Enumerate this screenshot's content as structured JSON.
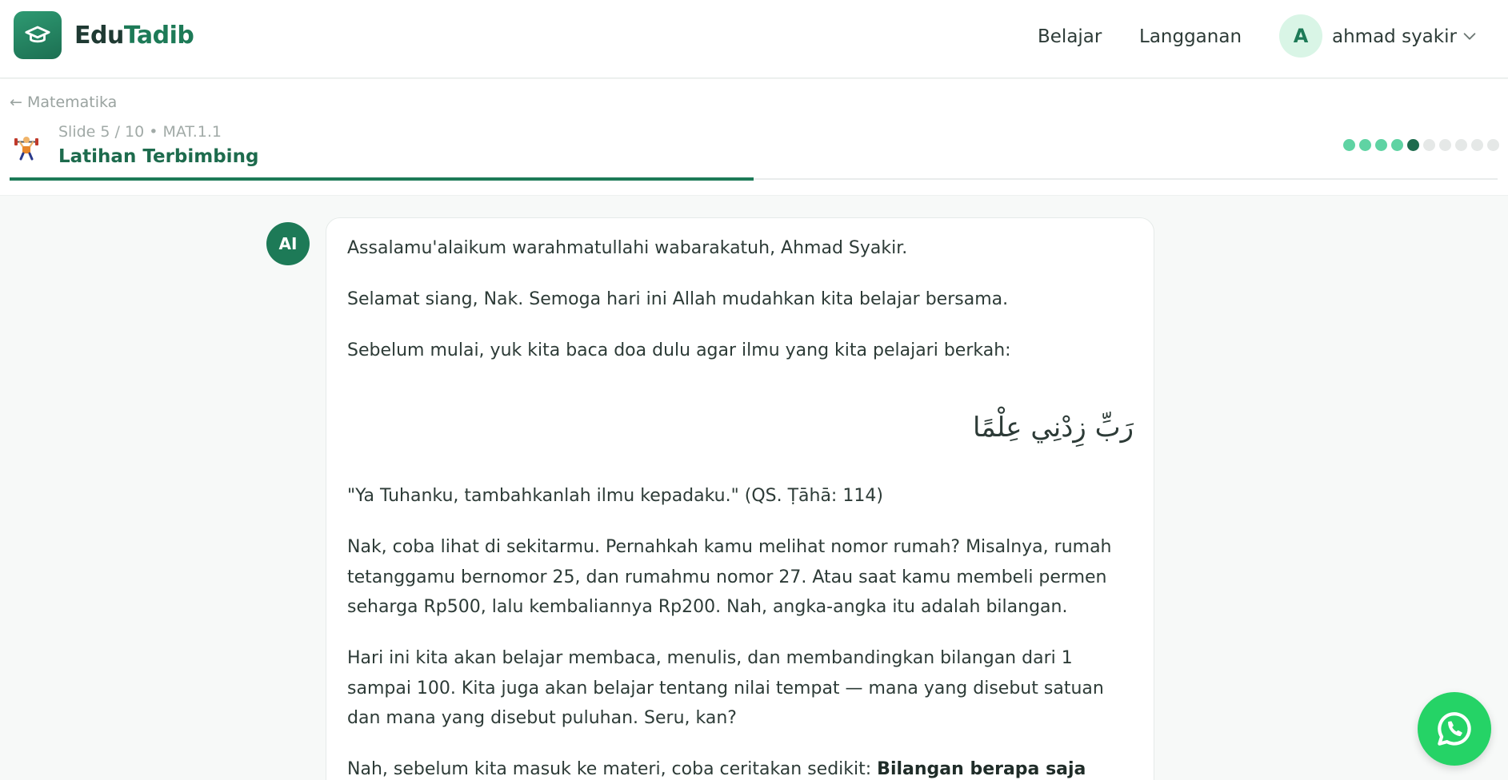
{
  "brand": {
    "edu": "Edu",
    "tadib": "Tadib",
    "logo_icon": "graduation-cap-icon"
  },
  "nav": {
    "learn": "Belajar",
    "subscription": "Langganan"
  },
  "user": {
    "initial": "A",
    "name": "ahmad syakir"
  },
  "lesson": {
    "back_label": "← Matematika",
    "meta": "Slide 5 / 10 • MAT.1.1",
    "title": "Latihan Terbimbing",
    "icon": "weightlifter-icon",
    "current_slide": 5,
    "total_slides": 10,
    "progress_fraction": 0.5
  },
  "chat": {
    "ai_label": "AI",
    "greeting": "Assalamu'alaikum warahmatullahi wabarakatuh, Ahmad Syakir.",
    "salutation": "Selamat siang, Nak. Semoga hari ini Allah mudahkan kita belajar bersama.",
    "intro_doa": "Sebelum mulai, yuk kita baca doa dulu agar ilmu yang kita pelajari berkah:",
    "arabic": "رَبِّ زِدْنِي عِلْمًا",
    "translation": "\"Ya Tuhanku, tambahkanlah ilmu kepadaku.\" (QS. Ṭāhā: 114)",
    "paragraph_1": "Nak, coba lihat di sekitarmu. Pernahkah kamu melihat nomor rumah? Misalnya, rumah tetanggamu bernomor 25, dan rumahmu nomor 27. Atau saat kamu membeli permen seharga Rp500, lalu kembaliannya Rp200. Nah, angka-angka itu adalah bilangan.",
    "paragraph_2": "Hari ini kita akan belajar membaca, menulis, dan membandingkan bilangan dari 1 sampai 100. Kita juga akan belajar tentang nilai tempat — mana yang disebut satuan dan mana yang disebut puluhan. Seru, kan?",
    "question_intro": "Nah, sebelum kita masuk ke materi, coba ceritakan sedikit: ",
    "question_bold": "Bilangan berapa saja yang"
  },
  "colors": {
    "brand": "#1d7a57",
    "accent": "#5fd3a3",
    "whatsapp": "#25d366"
  },
  "whatsapp": {
    "icon": "whatsapp-icon"
  }
}
